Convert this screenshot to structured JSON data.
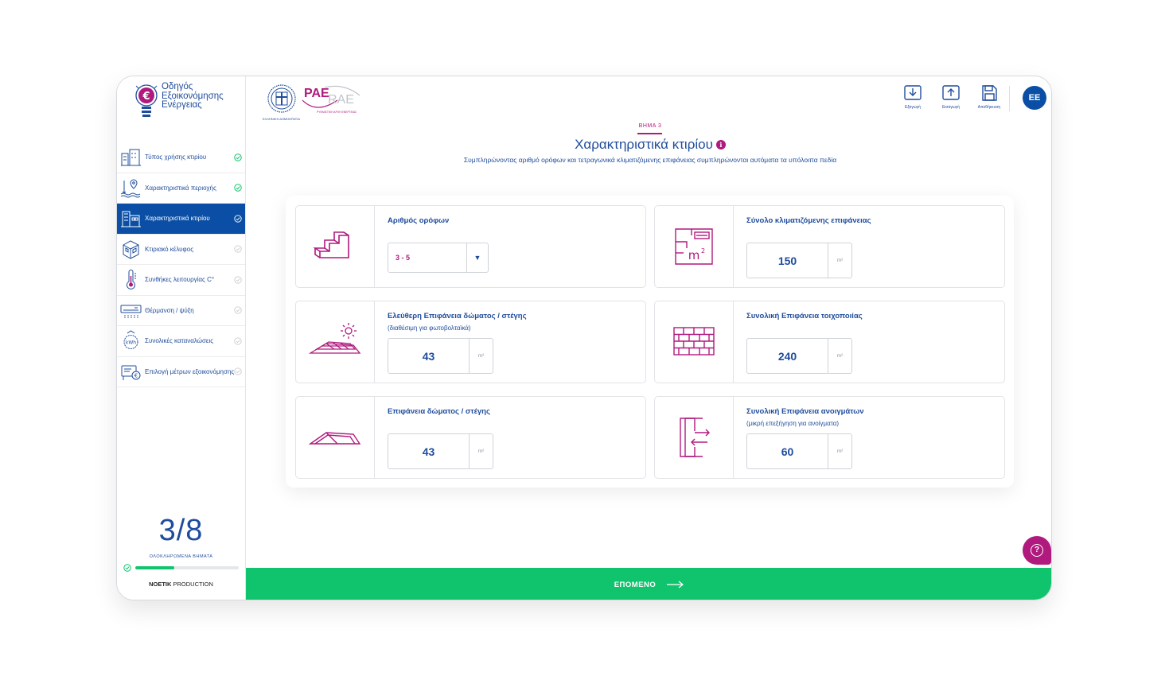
{
  "brand": {
    "line1": "Οδηγός",
    "line2": "Εξοικονόμησης",
    "line3": "Ενέργειας"
  },
  "sidebar": {
    "items": [
      {
        "label": "Τύπος χρήσης κτιρίου",
        "icon": "building-use-icon",
        "state": "done"
      },
      {
        "label": "Χαρακτηριστικά περιοχής",
        "icon": "area-location-icon",
        "state": "done"
      },
      {
        "label": "Χαρακτηριστικά κτιρίου",
        "icon": "building-characteristics-icon",
        "state": "active"
      },
      {
        "label": "Κτιριακό κέλυφος",
        "icon": "building-shell-icon",
        "state": "pending"
      },
      {
        "label": "Συνθήκες λειτουργίας C°",
        "icon": "thermometer-icon",
        "state": "pending"
      },
      {
        "label": "Θέρμανση / ψύξη",
        "icon": "air-conditioner-icon",
        "state": "pending"
      },
      {
        "label": "Συνολικές καταναλώσεις",
        "icon": "kwh-consumption-icon",
        "state": "pending"
      },
      {
        "label": "Επιλογή μέτρων εξοικονόμησης",
        "icon": "savings-measures-icon",
        "state": "pending"
      }
    ]
  },
  "progress": {
    "count": "3/8",
    "caption": "ΟΛΟΚΛΗΡΩΜΕΝΑ ΒΗΜΑΤΑ",
    "fraction": 0.375
  },
  "credit": {
    "bold": "NOETIK",
    "rest": " PRODUCTION"
  },
  "header": {
    "gov_caption": "ΕΛΛΗΝΙΚΗ ΔΗΜΟΚΡΑΤΙΑ",
    "rae_text": "ΡΑΕ",
    "rae_text_latin": "RAE",
    "rae_caption": "ΡΥΘΜΙΣΤΙΚΗ ΑΡΧΗ ΕΝΕΡΓΕΙΑΣ",
    "tools": [
      {
        "label": "Εξαγωγή",
        "icon": "download-icon"
      },
      {
        "label": "Εισαγωγή",
        "icon": "upload-icon"
      },
      {
        "label": "Αποθήκευση",
        "icon": "save-icon"
      }
    ],
    "avatar": "ΕΕ"
  },
  "page": {
    "step_label": "ΒΗΜΑ 3",
    "title": "Χαρακτηριστικά κτιρίου",
    "subtitle": "Συμπληρώνοντας αριθμό ορόφων και τετραγωνικά κλιματιζόμενης επιφάνειας συμπληρώνονται αυτόματα τα υπόλοιπα πεδία"
  },
  "form": {
    "floors": {
      "label": "Αριθμός ορόφων",
      "value": "3 - 5",
      "icon": "stairs-icon"
    },
    "conditioned_area": {
      "label": "Σύνολο κλιματιζόμενης επιφάνειας",
      "value": "150",
      "unit": "m²",
      "icon": "floorplan-m2-icon"
    },
    "free_roof_area": {
      "label": "Ελεύθερη Επιφάνεια δώματος / στέγης",
      "sub": "(διαθέσιμη για φωτοβολταϊκά)",
      "value": "43",
      "unit": "m²",
      "icon": "solar-roof-icon"
    },
    "wall_area": {
      "label": "Συνολική Επιφάνεια τοιχοποιίας",
      "value": "240",
      "unit": "m²",
      "icon": "brick-wall-icon"
    },
    "roof_area": {
      "label": "Επιφάνεια δώματος / στέγης",
      "value": "43",
      "unit": "m²",
      "icon": "roof-icon"
    },
    "openings_area": {
      "label": "Συνολική Επιφάνεια ανοιγμάτων",
      "sub": "(μικρή επεξήγηση για ανοίγματα)",
      "value": "60",
      "unit": "m²",
      "icon": "openings-icon"
    }
  },
  "footer": {
    "next_label": "ΕΠΟΜΕΝΟ"
  },
  "colors": {
    "primary": "#0a4fa5",
    "text": "#1f4c9c",
    "accent": "#b0197e",
    "success": "#10c46e"
  }
}
